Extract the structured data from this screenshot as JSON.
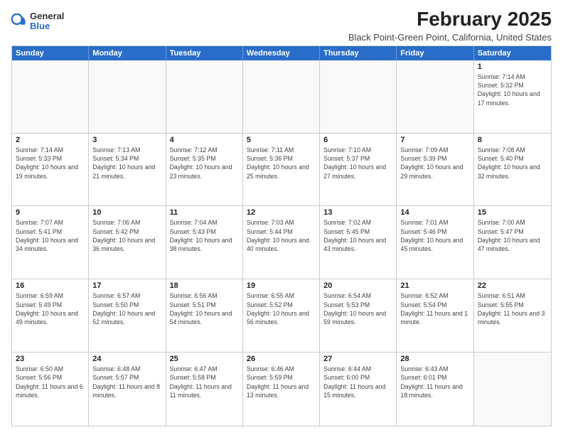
{
  "logo": {
    "general": "General",
    "blue": "Blue"
  },
  "title": "February 2025",
  "location": "Black Point-Green Point, California, United States",
  "days_of_week": [
    "Sunday",
    "Monday",
    "Tuesday",
    "Wednesday",
    "Thursday",
    "Friday",
    "Saturday"
  ],
  "weeks": [
    [
      {
        "day": "",
        "empty": true
      },
      {
        "day": "",
        "empty": true
      },
      {
        "day": "",
        "empty": true
      },
      {
        "day": "",
        "empty": true
      },
      {
        "day": "",
        "empty": true
      },
      {
        "day": "",
        "empty": true
      },
      {
        "day": "1",
        "sunrise": "7:14 AM",
        "sunset": "5:32 PM",
        "daylight": "10 hours and 17 minutes."
      }
    ],
    [
      {
        "day": "2",
        "sunrise": "7:14 AM",
        "sunset": "5:33 PM",
        "daylight": "10 hours and 19 minutes."
      },
      {
        "day": "3",
        "sunrise": "7:13 AM",
        "sunset": "5:34 PM",
        "daylight": "10 hours and 21 minutes."
      },
      {
        "day": "4",
        "sunrise": "7:12 AM",
        "sunset": "5:35 PM",
        "daylight": "10 hours and 23 minutes."
      },
      {
        "day": "5",
        "sunrise": "7:11 AM",
        "sunset": "5:36 PM",
        "daylight": "10 hours and 25 minutes."
      },
      {
        "day": "6",
        "sunrise": "7:10 AM",
        "sunset": "5:37 PM",
        "daylight": "10 hours and 27 minutes."
      },
      {
        "day": "7",
        "sunrise": "7:09 AM",
        "sunset": "5:39 PM",
        "daylight": "10 hours and 29 minutes."
      },
      {
        "day": "8",
        "sunrise": "7:08 AM",
        "sunset": "5:40 PM",
        "daylight": "10 hours and 32 minutes."
      }
    ],
    [
      {
        "day": "9",
        "sunrise": "7:07 AM",
        "sunset": "5:41 PM",
        "daylight": "10 hours and 34 minutes."
      },
      {
        "day": "10",
        "sunrise": "7:06 AM",
        "sunset": "5:42 PM",
        "daylight": "10 hours and 36 minutes."
      },
      {
        "day": "11",
        "sunrise": "7:04 AM",
        "sunset": "5:43 PM",
        "daylight": "10 hours and 38 minutes."
      },
      {
        "day": "12",
        "sunrise": "7:03 AM",
        "sunset": "5:44 PM",
        "daylight": "10 hours and 40 minutes."
      },
      {
        "day": "13",
        "sunrise": "7:02 AM",
        "sunset": "5:45 PM",
        "daylight": "10 hours and 43 minutes."
      },
      {
        "day": "14",
        "sunrise": "7:01 AM",
        "sunset": "5:46 PM",
        "daylight": "10 hours and 45 minutes."
      },
      {
        "day": "15",
        "sunrise": "7:00 AM",
        "sunset": "5:47 PM",
        "daylight": "10 hours and 47 minutes."
      }
    ],
    [
      {
        "day": "16",
        "sunrise": "6:59 AM",
        "sunset": "5:49 PM",
        "daylight": "10 hours and 49 minutes."
      },
      {
        "day": "17",
        "sunrise": "6:57 AM",
        "sunset": "5:50 PM",
        "daylight": "10 hours and 52 minutes."
      },
      {
        "day": "18",
        "sunrise": "6:56 AM",
        "sunset": "5:51 PM",
        "daylight": "10 hours and 54 minutes."
      },
      {
        "day": "19",
        "sunrise": "6:55 AM",
        "sunset": "5:52 PM",
        "daylight": "10 hours and 56 minutes."
      },
      {
        "day": "20",
        "sunrise": "6:54 AM",
        "sunset": "5:53 PM",
        "daylight": "10 hours and 59 minutes."
      },
      {
        "day": "21",
        "sunrise": "6:52 AM",
        "sunset": "5:54 PM",
        "daylight": "11 hours and 1 minute."
      },
      {
        "day": "22",
        "sunrise": "6:51 AM",
        "sunset": "5:55 PM",
        "daylight": "11 hours and 3 minutes."
      }
    ],
    [
      {
        "day": "23",
        "sunrise": "6:50 AM",
        "sunset": "5:56 PM",
        "daylight": "11 hours and 6 minutes."
      },
      {
        "day": "24",
        "sunrise": "6:48 AM",
        "sunset": "5:57 PM",
        "daylight": "11 hours and 8 minutes."
      },
      {
        "day": "25",
        "sunrise": "6:47 AM",
        "sunset": "5:58 PM",
        "daylight": "11 hours and 11 minutes."
      },
      {
        "day": "26",
        "sunrise": "6:46 AM",
        "sunset": "5:59 PM",
        "daylight": "11 hours and 13 minutes."
      },
      {
        "day": "27",
        "sunrise": "6:44 AM",
        "sunset": "6:00 PM",
        "daylight": "11 hours and 15 minutes."
      },
      {
        "day": "28",
        "sunrise": "6:43 AM",
        "sunset": "6:01 PM",
        "daylight": "11 hours and 18 minutes."
      },
      {
        "day": "",
        "empty": true
      }
    ]
  ]
}
